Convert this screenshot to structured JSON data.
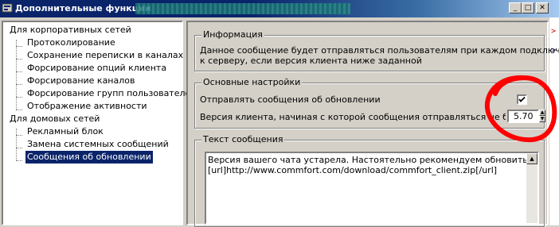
{
  "window": {
    "title": "Дополнительные функции",
    "minimize_glyph": "_",
    "maximize_glyph": "□",
    "close_glyph": "✕"
  },
  "outside_glyphs": [
    ">",
    ">"
  ],
  "tree": {
    "groups": [
      {
        "label": "Для корпоративных сетей",
        "children": [
          "Протоколирование",
          "Сохранение переписки в каналах",
          "Форсирование опций клиента",
          "Форсирование каналов",
          "Форсирование групп пользователей",
          "Отображение активности"
        ]
      },
      {
        "label": "Для домовых сетей",
        "children": [
          "Рекламный блок",
          "Замена системных сообщений",
          "Сообщения об обновлении"
        ]
      }
    ],
    "selected": "Сообщения об обновлении"
  },
  "info_group": {
    "caption": "Информация",
    "line1": "Данное сообщение будет отправляться пользователям при каждом подключении",
    "line2": "к серверу, если версия клиента ниже заданной"
  },
  "settings_group": {
    "caption": "Основные настройки",
    "send_updates_label": "Отправлять сообщения об обновлении",
    "send_updates_checked": true,
    "version_label": "Версия клиента, начиная с которой сообщения отправляться не будут",
    "version_value": "5.70"
  },
  "message_group": {
    "caption": "Текст сообщения",
    "lines": [
      "Версия вашего чата устарела. Настоятельно рекомендуем обновить!",
      "[url]http://www.commfort.com/download/commfort_client.zip[/url]"
    ]
  },
  "colors": {
    "titlebar": "#0a246a",
    "selection": "#0a246a",
    "face": "#d4d0c8",
    "annotation": "#ff0000"
  }
}
